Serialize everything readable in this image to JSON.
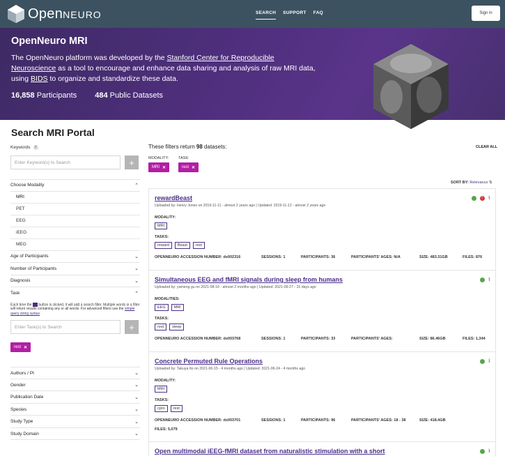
{
  "nav": {
    "logo_text_1": "Open",
    "logo_text_2": "NEURO",
    "links": [
      "SEARCH",
      "SUPPORT",
      "FAQ"
    ],
    "sign_in": "Sign in"
  },
  "hero": {
    "title": "OpenNeuro MRI",
    "desc_1": "The OpenNeuro platform was developed by the ",
    "desc_link_1": "Stanford Center for Reproducible Neuroscience",
    "desc_2": " as a tool to encourage and enhance data sharing and analysis of raw MRI data, using ",
    "desc_link_2": "BIDS",
    "desc_3": " to organize and standardize these data.",
    "participants_count": "16,858",
    "participants_label": "Participants",
    "datasets_count": "484",
    "datasets_label": "Public Datasets"
  },
  "search": {
    "title": "Search MRI Portal",
    "keywords_label": "Keywords",
    "keywords_placeholder": "Enter Keyword(s) to Search",
    "plus": "+",
    "modality_label": "Choose Modality",
    "modalities": [
      "MRI",
      "PET",
      "EEG",
      "iEEG",
      "MEG"
    ],
    "facets_a": [
      "Age of Participants",
      "Number of Participants",
      "Diagnosis"
    ],
    "task_label": "Task",
    "task_help_1": "Each time the",
    "task_help_2": "button is clicked, it will add a search filter. Multiple words in a filter will return results containing any or all words. For advanced filters use the",
    "task_help_link": "simple query string syntax",
    "task_placeholder": "Enter Task(s) to Search",
    "task_chip": "rest",
    "facets_b": [
      "Authors / PI",
      "Gender",
      "Publication Date",
      "Species",
      "Study Type",
      "Study Domain"
    ]
  },
  "results": {
    "head_1": "These filters return ",
    "count": "98",
    "head_2": " datasets:",
    "clear_all": "CLEAR ALL",
    "modality_filter_label": "MODALITY:",
    "modality_chip": "MRI",
    "task_filter_label": "TASK:",
    "task_chip": "rest",
    "sort_label": "SORT BY:",
    "sort_value": "Relevance",
    "cards": [
      {
        "title": "rewardBeast",
        "sub": "Uploaded by: Henry Jones on 2019-11-11 - almost 2 years ago   |   Updated: 2019-11-12 - almost 2 years ago",
        "mod_label": "MODALITY:",
        "mods": [
          "MRI"
        ],
        "task_label": "TASKS:",
        "tasks": [
          "reward",
          "Beast",
          "rest"
        ],
        "accession": "ds002316",
        "sessions": "1",
        "participants": "36",
        "ages": "N/A",
        "size": "483.31GB",
        "files": "876"
      },
      {
        "title": "Simultaneous EEG and fMRI signals during sleep from humans",
        "sub": "Uploaded by: yameng gu on 2021-08-16 - almost 2 months ago   |   Updated: 2021-09-27 - 15 days ago",
        "mod_label": "MODALITIES:",
        "mods": [
          "EEG",
          "MRI"
        ],
        "task_label": "TASKS:",
        "tasks": [
          "rest",
          "sleep"
        ],
        "accession": "ds003768",
        "sessions": "1",
        "participants": "33",
        "ages": "",
        "size": "86.46GB",
        "files": "1,344"
      },
      {
        "title": "Concrete Permuted Rule Operations",
        "sub": "Uploaded by: Takuya Ito on 2021-06-15 - 4 months ago   |   Updated: 2021-06-24 - 4 months ago",
        "mod_label": "MODALITY:",
        "mods": [
          "MRI"
        ],
        "task_label": "TASKS:",
        "tasks": [
          "cpro",
          "rest"
        ],
        "accession": "ds003701",
        "sessions": "1",
        "participants": "96",
        "ages": "18 - 38",
        "size": "418.4GB",
        "files": "5,079"
      },
      {
        "title": "Open multimodal iEEG-fMRI dataset from naturalistic stimulation with a short"
      }
    ],
    "lbl_accession": "OPENNEURO ACCESSION NUMBER:",
    "lbl_sessions": "SESSIONS:",
    "lbl_participants": "PARTICIPANTS:",
    "lbl_ages": "PARTICIPANTS' AGES:",
    "lbl_size": "SIZE:",
    "lbl_files": "FILES:"
  },
  "colors": {
    "nav": "#3c5260",
    "hero": "#4f2f7e",
    "accent": "#4b2f8a",
    "chip": "#b21fa5"
  },
  "icons": [
    "logo-icon",
    "help-icon",
    "close-icon",
    "chevron-up-icon",
    "chevron-down-icon",
    "globe-icon",
    "error-icon",
    "activity-icon",
    "sort-icon"
  ]
}
